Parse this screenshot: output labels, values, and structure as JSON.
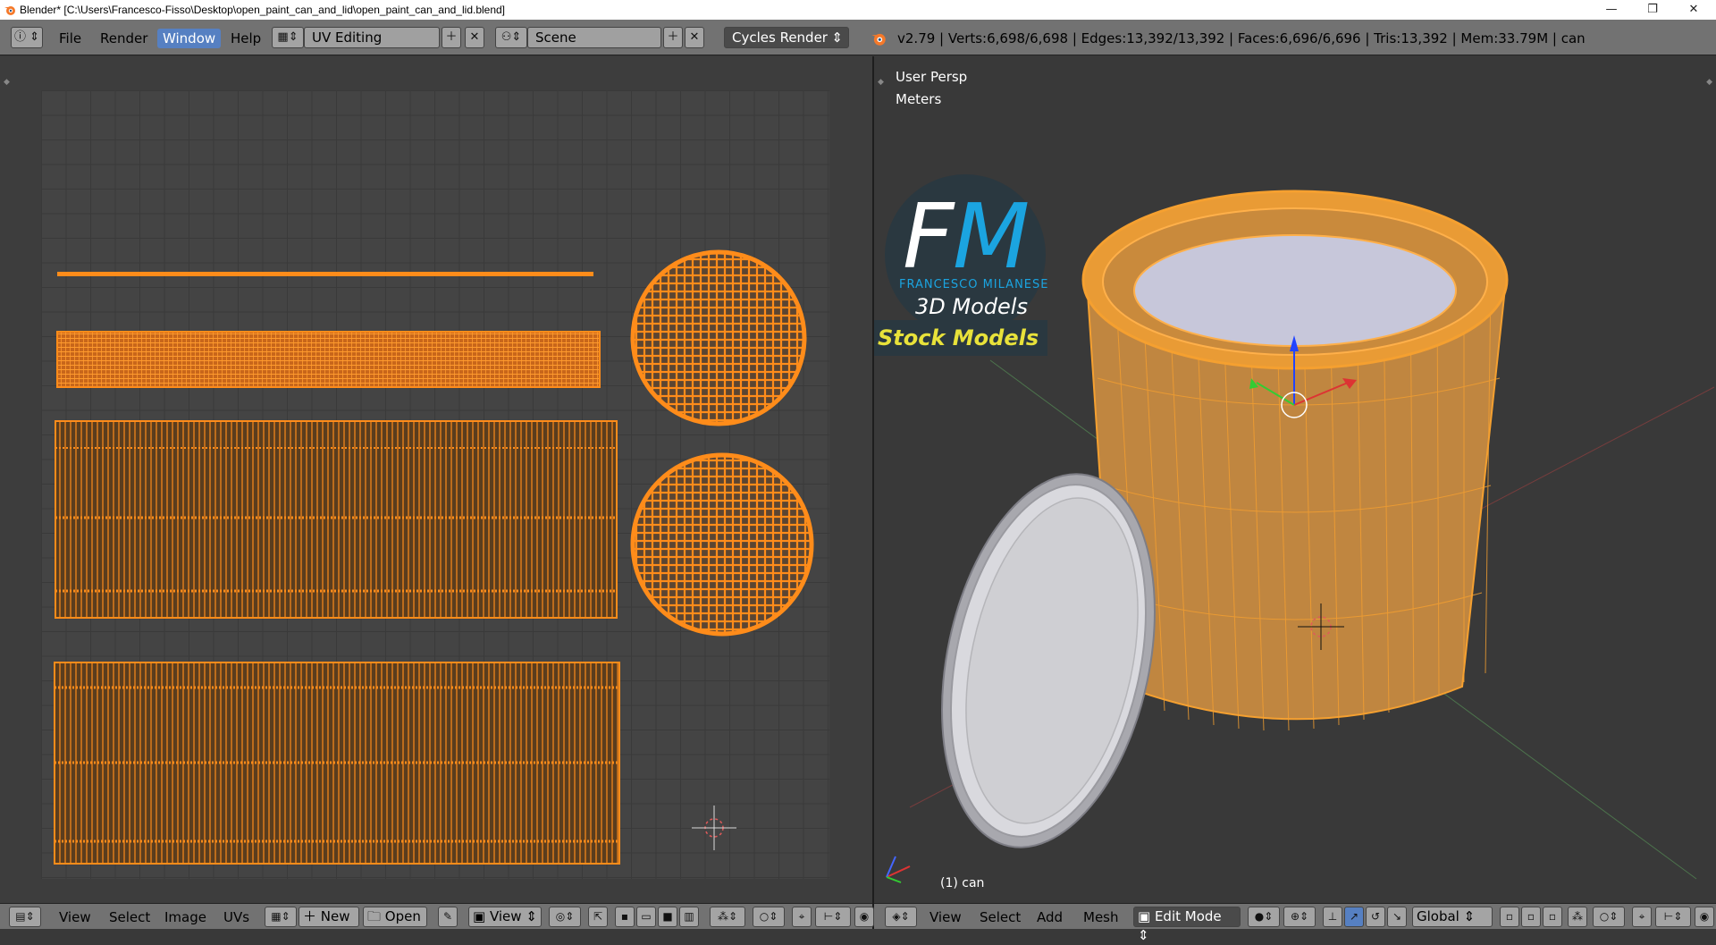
{
  "window": {
    "title": "Blender* [C:\\Users\\Francesco-Fisso\\Desktop\\open_paint_can_and_lid\\open_paint_can_and_lid.blend]",
    "controls": {
      "minimize": "—",
      "restore": "❐",
      "close": "✕"
    }
  },
  "menu": {
    "items": [
      "File",
      "Render",
      "Window",
      "Help"
    ],
    "active": "Window"
  },
  "layout_selector": {
    "value": "UV Editing"
  },
  "scene_selector": {
    "value": "Scene"
  },
  "render_engine": {
    "value": "Cycles Render"
  },
  "stats": "v2.79 | Verts:6,698/6,698 | Edges:13,392/13,392 | Faces:6,696/6,696 | Tris:13,392 | Mem:33.79M | can",
  "viewport": {
    "view_name": "User Persp",
    "units": "Meters",
    "object_label": "(1) can"
  },
  "logo": {
    "initials_f": "F",
    "initials_m": "M",
    "name": "FRANCESCO MILANESE",
    "tagline": "3D Models",
    "banner": "Stock Models",
    "colors": {
      "f": "#ffffff",
      "m": "#1ba4e0",
      "banner_text": "#e8e23a"
    }
  },
  "uv_editor_header": {
    "menus": [
      "View",
      "Select",
      "Image",
      "UVs"
    ],
    "new_label": "New",
    "open_label": "Open",
    "view_label": "View"
  },
  "viewport_header": {
    "menus": [
      "View",
      "Select",
      "Add",
      "Mesh"
    ],
    "mode": "Edit Mode",
    "orientation": "Global"
  },
  "colors": {
    "accent": "#5680c2",
    "uv_orange": "#ff8c1a",
    "mesh_orange": "#f5a030"
  }
}
